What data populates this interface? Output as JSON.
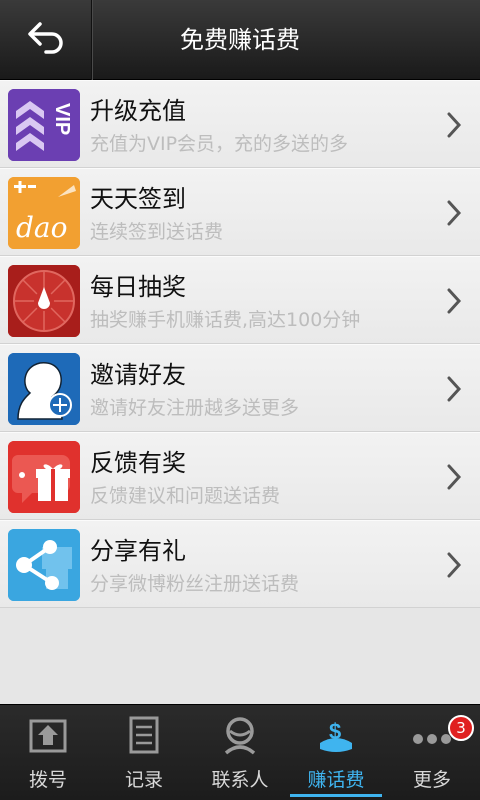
{
  "header": {
    "title": "免费赚话费"
  },
  "items": [
    {
      "name": "升级充值",
      "desc": "充值为VIP会员，充的多送的多",
      "icon": "vip-icon",
      "color": "#6b3fb2"
    },
    {
      "name": "天天签到",
      "desc": "连续签到送话费",
      "icon": "dao-icon",
      "color": "#f2a031",
      "icon_text": "dao"
    },
    {
      "name": "每日抽奖",
      "desc": "抽奖赚手机赚话费,高达100分钟",
      "icon": "lottery-wheel-icon",
      "color": "#b5231f"
    },
    {
      "name": "邀请好友",
      "desc": "邀请好友注册越多送更多",
      "icon": "invite-friend-icon",
      "color": "#1e6ab8"
    },
    {
      "name": "反馈有奖",
      "desc": "反馈建议和问题送话费",
      "icon": "gift-feedback-icon",
      "color": "#e0312d"
    },
    {
      "name": "分享有礼",
      "desc": "分享微博粉丝注册送话费",
      "icon": "share-icon",
      "color": "#3aa6e0"
    }
  ],
  "tabs": [
    {
      "label": "拨号",
      "icon": "dial-icon"
    },
    {
      "label": "记录",
      "icon": "records-icon"
    },
    {
      "label": "联系人",
      "icon": "contacts-icon"
    },
    {
      "label": "赚话费",
      "icon": "earn-credit-icon",
      "active": true
    },
    {
      "label": "更多",
      "icon": "more-icon",
      "badge": "3"
    }
  ]
}
